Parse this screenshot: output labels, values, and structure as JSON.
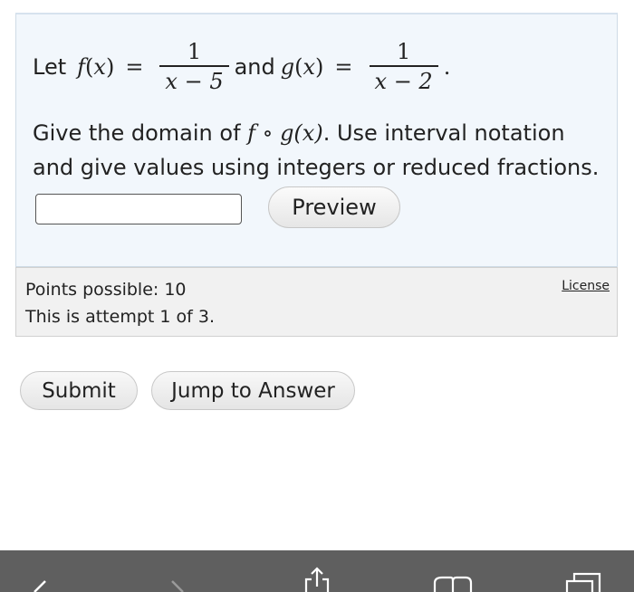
{
  "question": {
    "let": "Let",
    "f_name": "f",
    "x_var": "x",
    "eq": "=",
    "f_num": "1",
    "f_den": "x − 5",
    "and": "and",
    "g_name": "g",
    "g_num": "1",
    "g_den": "x − 2",
    "period": ".",
    "prompt_a": "Give the domain of ",
    "prompt_compose": "f ∘ g(x)",
    "prompt_b": ". Use interval notation and give values using integers or reduced fractions."
  },
  "answer_input": {
    "value": "",
    "placeholder": ""
  },
  "preview_label": "Preview",
  "info": {
    "points": "Points possible: 10",
    "attempt": "This is attempt 1 of 3.",
    "license": "License"
  },
  "actions": {
    "submit": "Submit",
    "jump": "Jump to Answer"
  },
  "bottom_bar": {
    "color": "#5f5f5f",
    "icons": [
      "back-icon",
      "forward-icon",
      "share-icon",
      "bookmarks-icon",
      "tabs-icon"
    ]
  }
}
